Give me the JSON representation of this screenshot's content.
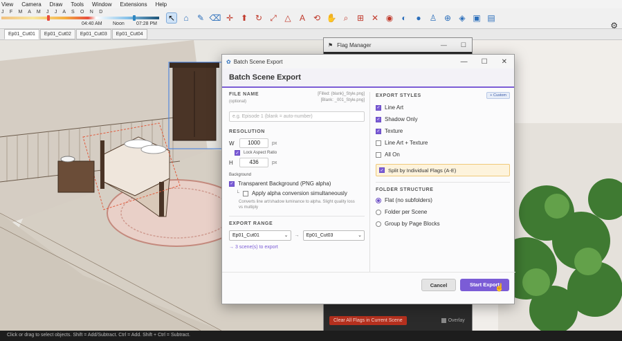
{
  "menubar": [
    "View",
    "Camera",
    "Draw",
    "Tools",
    "Window",
    "Extensions",
    "Help"
  ],
  "shadow": {
    "months": "J F M A M J J A S O N D",
    "time_start": "04:40 AM",
    "time_noon": "Noon",
    "time_end": "07:28 PM"
  },
  "scene_tabs": [
    "Ep01_Cut01",
    "Ep01_Cut02",
    "Ep01_Cut03",
    "Ep01_Cut04"
  ],
  "flag_manager": {
    "title": "Flag Manager",
    "clear_button": "Clear All Flags in Current Scene",
    "overlay_label": "Overlay"
  },
  "dialog": {
    "window_title": "Batch Scene Export",
    "header": "Batch Scene Export",
    "file_name": {
      "label": "FILE NAME",
      "optional": "(optional)",
      "hint1": "[Filled: {blank}_Style.png]",
      "hint2": "[Blank: _001_Style.png]",
      "placeholder": "e.g. Episode 1  (blank = auto-number)"
    },
    "resolution": {
      "label": "RESOLUTION",
      "w_label": "W",
      "w_value": "1000",
      "w_unit": "px",
      "lock_label": "Lock Aspect Ratio",
      "h_label": "H",
      "h_value": "436",
      "h_unit": "px"
    },
    "background": {
      "label": "Background",
      "transparent_label": "Transparent Background (PNG alpha)",
      "alpha_label": "Apply alpha conversion simultaneously",
      "alpha_note": "Converts line art/shadow luminance to alpha. Slight quality loss vs multiply"
    },
    "export_range": {
      "label": "EXPORT RANGE",
      "from": "Ep01_Cut01",
      "to": "Ep01_Cut03",
      "arrow": "→",
      "count": "→ 3 scene(s) to export"
    },
    "export_styles": {
      "label": "EXPORT STYLES",
      "custom_button": "+ Custom",
      "items": [
        "Line Art",
        "Shadow Only",
        "Texture",
        "Line Art + Texture",
        "All On"
      ],
      "checked": [
        true,
        true,
        true,
        false,
        false
      ],
      "split_label": "Split by Individual Flags (A-E)"
    },
    "folder_structure": {
      "label": "FOLDER STRUCTURE",
      "options": [
        "Flat (no subfolders)",
        "Folder per Scene",
        "Group by Page Blocks"
      ],
      "selected": 0
    },
    "cancel_label": "Cancel",
    "start_label": "Start Export"
  },
  "statusbar": "Click or drag to select objects. Shift = Add/Subtract. Ctrl = Add. Shift + Ctrl = Subtract.",
  "colors": {
    "accent": "#7b5cd6",
    "clear_red": "#b5301e"
  }
}
